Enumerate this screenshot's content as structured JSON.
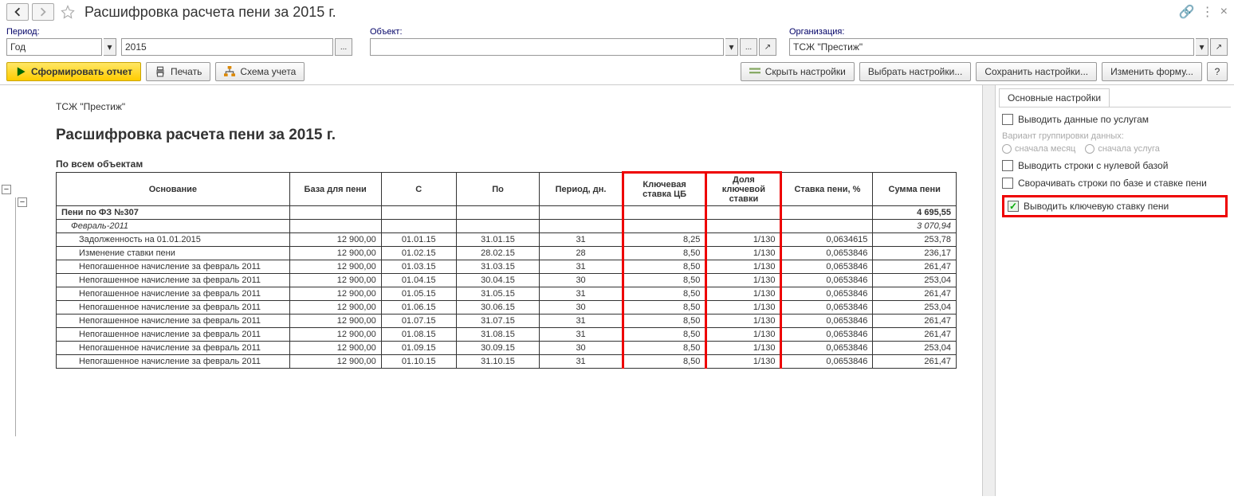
{
  "title": "Расшифровка расчета пени  за 2015 г.",
  "params": {
    "period_label": "Период:",
    "period_type": "Год",
    "period_value": "2015",
    "object_label": "Объект:",
    "object_value": "",
    "org_label": "Организация:",
    "org_value": "ТСЖ \"Престиж\""
  },
  "toolbar": {
    "generate": "Сформировать отчет",
    "print": "Печать",
    "scheme": "Схема учета",
    "hide_settings": "Скрыть настройки",
    "choose_settings": "Выбрать настройки...",
    "save_settings": "Сохранить настройки...",
    "edit_form": "Изменить форму...",
    "help": "?"
  },
  "report": {
    "org": "ТСЖ \"Престиж\"",
    "title": "Расшифровка расчета пени за 2015 г.",
    "subtitle": "По всем объектам",
    "headers": {
      "osn": "Основание",
      "base": "База для пени",
      "c": "С",
      "po": "По",
      "period": "Период, дн.",
      "rate": "Ключевая ставка ЦБ",
      "share": "Доля ключевой ставки",
      "peni_rate": "Ставка пени, %",
      "sum": "Сумма пени"
    },
    "section": {
      "name": "Пени по ФЗ №307",
      "sum": "4 695,55"
    },
    "subsection": {
      "name": "Февраль-2011",
      "sum": "3 070,94"
    },
    "rows": [
      {
        "osn": "Задолженность на 01.01.2015",
        "base": "12 900,00",
        "c": "01.01.15",
        "po": "31.01.15",
        "per": "31",
        "rate": "8,25",
        "share": "1/130",
        "pr": "0,0634615",
        "sum": "253,78"
      },
      {
        "osn": "Изменение ставки пени",
        "base": "12 900,00",
        "c": "01.02.15",
        "po": "28.02.15",
        "per": "28",
        "rate": "8,50",
        "share": "1/130",
        "pr": "0,0653846",
        "sum": "236,17"
      },
      {
        "osn": "Непогашенное начисление за февраль 2011",
        "base": "12 900,00",
        "c": "01.03.15",
        "po": "31.03.15",
        "per": "31",
        "rate": "8,50",
        "share": "1/130",
        "pr": "0,0653846",
        "sum": "261,47"
      },
      {
        "osn": "Непогашенное начисление за февраль 2011",
        "base": "12 900,00",
        "c": "01.04.15",
        "po": "30.04.15",
        "per": "30",
        "rate": "8,50",
        "share": "1/130",
        "pr": "0,0653846",
        "sum": "253,04"
      },
      {
        "osn": "Непогашенное начисление за февраль 2011",
        "base": "12 900,00",
        "c": "01.05.15",
        "po": "31.05.15",
        "per": "31",
        "rate": "8,50",
        "share": "1/130",
        "pr": "0,0653846",
        "sum": "261,47"
      },
      {
        "osn": "Непогашенное начисление за февраль 2011",
        "base": "12 900,00",
        "c": "01.06.15",
        "po": "30.06.15",
        "per": "30",
        "rate": "8,50",
        "share": "1/130",
        "pr": "0,0653846",
        "sum": "253,04"
      },
      {
        "osn": "Непогашенное начисление за февраль 2011",
        "base": "12 900,00",
        "c": "01.07.15",
        "po": "31.07.15",
        "per": "31",
        "rate": "8,50",
        "share": "1/130",
        "pr": "0,0653846",
        "sum": "261,47"
      },
      {
        "osn": "Непогашенное начисление за февраль 2011",
        "base": "12 900,00",
        "c": "01.08.15",
        "po": "31.08.15",
        "per": "31",
        "rate": "8,50",
        "share": "1/130",
        "pr": "0,0653846",
        "sum": "261,47"
      },
      {
        "osn": "Непогашенное начисление за февраль 2011",
        "base": "12 900,00",
        "c": "01.09.15",
        "po": "30.09.15",
        "per": "30",
        "rate": "8,50",
        "share": "1/130",
        "pr": "0,0653846",
        "sum": "253,04"
      },
      {
        "osn": "Непогашенное начисление за февраль 2011",
        "base": "12 900,00",
        "c": "01.10.15",
        "po": "31.10.15",
        "per": "31",
        "rate": "8,50",
        "share": "1/130",
        "pr": "0,0653846",
        "sum": "261,47"
      }
    ]
  },
  "settings": {
    "tab": "Основные настройки",
    "by_service": "Выводить данные по услугам",
    "group_label": "Вариант группировки данных:",
    "r1": "сначала месяц",
    "r2": "сначала услуга",
    "zero_base": "Выводить строки с нулевой базой",
    "collapse": "Сворачивать строки по базе и ставке пени",
    "key_rate": "Выводить ключевую ставку пени"
  }
}
